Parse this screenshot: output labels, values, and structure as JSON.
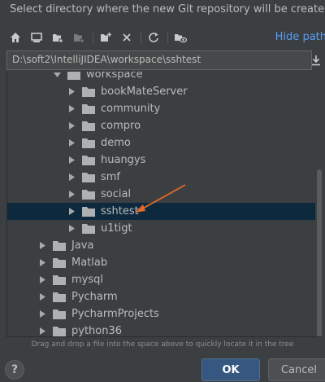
{
  "dialog": {
    "description": "Select directory where the new Git repository will be created.",
    "hide_path_label": "Hide path",
    "path_value": "D:\\soft2\\IntelliJIDEA\\workspace\\sshtest",
    "hint": "Drag and drop a file into the space above to quickly locate it in the tree",
    "help_label": "?",
    "ok_label": "OK",
    "cancel_label": "Cancel"
  },
  "toolbar": {
    "icons": [
      "home-icon",
      "desktop-icon",
      "project-folder-icon",
      "module-folder-icon",
      "new-folder-icon",
      "delete-icon",
      "refresh-icon",
      "show-hidden-icon"
    ]
  },
  "tree": {
    "parent": {
      "label": "workspace",
      "expanded": true
    },
    "children": [
      {
        "label": "bookMateServer"
      },
      {
        "label": "community"
      },
      {
        "label": "compro"
      },
      {
        "label": "demo"
      },
      {
        "label": "huangys"
      },
      {
        "label": "smf"
      },
      {
        "label": "social"
      },
      {
        "label": "sshtest",
        "selected": true
      },
      {
        "label": "u1tigt"
      }
    ],
    "siblings": [
      {
        "label": "Java"
      },
      {
        "label": "Matlab"
      },
      {
        "label": "mysql"
      },
      {
        "label": "Pycharm"
      },
      {
        "label": "PycharmProjects"
      },
      {
        "label": "python36"
      }
    ]
  },
  "colors": {
    "background": "#3c3f41",
    "selection": "#0d293e",
    "link": "#589df6",
    "annotation_arrow": "#e06a2a",
    "ok_button": "#365880"
  }
}
